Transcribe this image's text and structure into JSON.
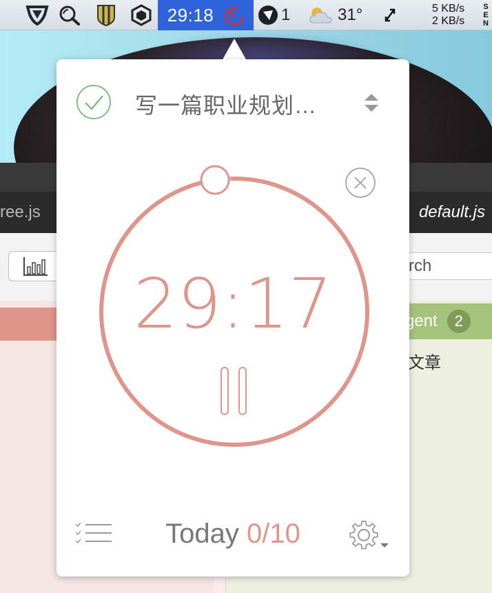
{
  "menubar": {
    "timer": "29:18",
    "notif_count": "1",
    "temperature": "31°",
    "net_up": "5 KB/s",
    "net_down": "2 KB/s",
    "vertical_letters": [
      "S",
      "E",
      "N"
    ]
  },
  "background_app": {
    "tab_left": "ree.js",
    "tab_right": "default.js",
    "search_placeholder": "rch",
    "group_label": "gent",
    "group_badge": "2",
    "item_text": "文章"
  },
  "popover": {
    "task_title": "写一篇职业规划…",
    "timer": "29:17",
    "today_label": "Today",
    "today_count": "0/10",
    "progress_fraction": 0.0006,
    "colors": {
      "accent": "#df958a",
      "check": "#7cc07e",
      "menubar_highlight": "#2e63d9"
    }
  }
}
